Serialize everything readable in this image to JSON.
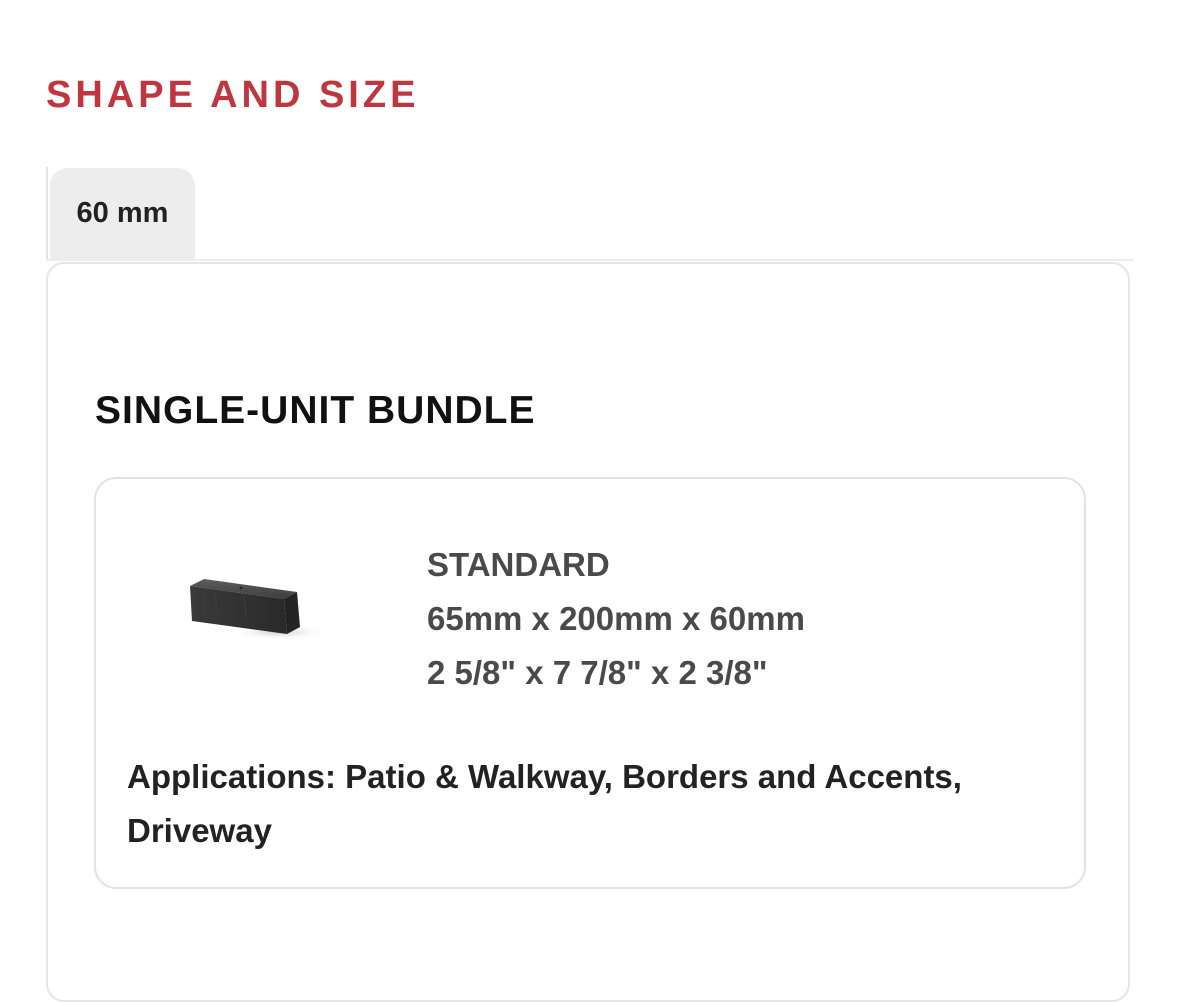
{
  "section": {
    "title": "SHAPE AND SIZE"
  },
  "tabs": [
    {
      "label": "60 mm",
      "active": true
    }
  ],
  "panel": {
    "heading": "SINGLE-UNIT BUNDLE",
    "card": {
      "image_icon": "paver-brick-image",
      "name": "STANDARD",
      "dimensions_metric": "65mm x 200mm x 60mm",
      "dimensions_imperial": "2 5/8\" x 7 7/8\" x 2 3/8\"",
      "applications": "Applications: Patio & Walkway, Borders and Accents, Driveway"
    }
  },
  "colors": {
    "accent": "#c0363f",
    "tab_background": "#ededed",
    "border": "#e6e6e6",
    "spec_text": "#4a4a4a"
  }
}
